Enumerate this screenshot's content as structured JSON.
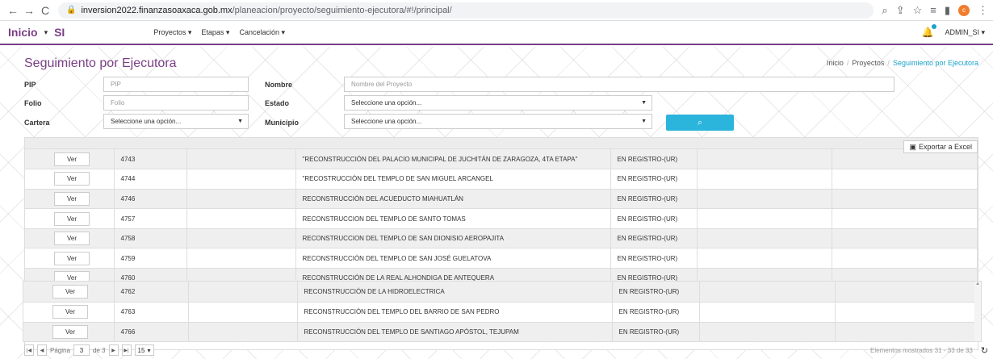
{
  "browser": {
    "url_host": "inversion2022.finanzasoaxaca.gob.mx",
    "url_path": "/planeacion/proyecto/seguimiento-ejecutora/#!/principal/",
    "profile_initial": "c"
  },
  "navbar": {
    "home": "Inicio",
    "app": "SI",
    "menu": [
      "Proyectos",
      "Etapas",
      "Cancelación"
    ],
    "user": "ADMIN_SI"
  },
  "page": {
    "title": "Seguimiento por Ejecutora",
    "breadcrumb": [
      "Inicio",
      "Proyectos",
      "Seguimiento por Ejecutora"
    ]
  },
  "form": {
    "pip_label": "PIP",
    "pip_placeholder": "PIP",
    "folio_label": "Folio",
    "folio_placeholder": "Folio",
    "cartera_label": "Cartera",
    "cartera_value": "Seleccione una opción...",
    "nombre_label": "Nombre",
    "nombre_placeholder": "Nombre del Proyecto",
    "estado_label": "Estado",
    "estado_value": "Seleccione una opción...",
    "municipio_label": "Municipio",
    "municipio_value": "Seleccione una opción..."
  },
  "grid": {
    "export_label": "Exportar a Excel",
    "view_label": "Ver",
    "rows": [
      {
        "id": "4743",
        "name": "\"RECONSTRUCCIÓN DEL PALACIO MUNICIPAL DE JUCHITÁN DE ZARAGOZA, 4TA ETAPA\"",
        "status": "EN REGISTRO-(UR)"
      },
      {
        "id": "4744",
        "name": "\"RECOSTRUCCIÓN DEL TEMPLO DE SAN MIGUEL ARCANGEL",
        "status": "EN REGISTRO-(UR)"
      },
      {
        "id": "4746",
        "name": "RECONSTRUCCIÓN DEL ACUEDUCTO MIAHUATLÁN",
        "status": "EN REGISTRO-(UR)"
      },
      {
        "id": "4757",
        "name": "RECONSTRUCCION DEL TEMPLO DE SANTO TOMAS",
        "status": "EN REGISTRO-(UR)"
      },
      {
        "id": "4758",
        "name": "RECONSTRUCCION DEL TEMPLO DE SAN DIONISIO AEROPAJITA",
        "status": "EN REGISTRO-(UR)"
      },
      {
        "id": "4759",
        "name": "RECONSTRUCCIÓN DEL TEMPLO DE SAN JOSÉ GUELATOVA",
        "status": "EN REGISTRO-(UR)"
      },
      {
        "id": "4760",
        "name": "RECONSTRUCCIÓN DE LA REAL ALHONDIGA DE ANTEQUERA",
        "status": "EN REGISTRO-(UR)"
      }
    ],
    "rows2": [
      {
        "id": "4762",
        "name": "RECONSTRUCCIÓN DE LA HIDROELECTRICA",
        "status": "EN REGISTRO-(UR)"
      },
      {
        "id": "4763",
        "name": "RECONSTRUCCIÓN DEL TEMPLO DEL BARRIO DE SAN PEDRO",
        "status": "EN REGISTRO-(UR)"
      },
      {
        "id": "4766",
        "name": "RECONSTRUCCIÓN DEL TEMPLO DE SANTIAGO APÓSTOL, TEJUPAM",
        "status": "EN REGISTRO-(UR)"
      }
    ]
  },
  "pager": {
    "page_label": "Página",
    "page_value": "3",
    "of_label": "de 3",
    "page_size": "15",
    "info": "Elementos mostrados 31 - 33 de 33"
  }
}
